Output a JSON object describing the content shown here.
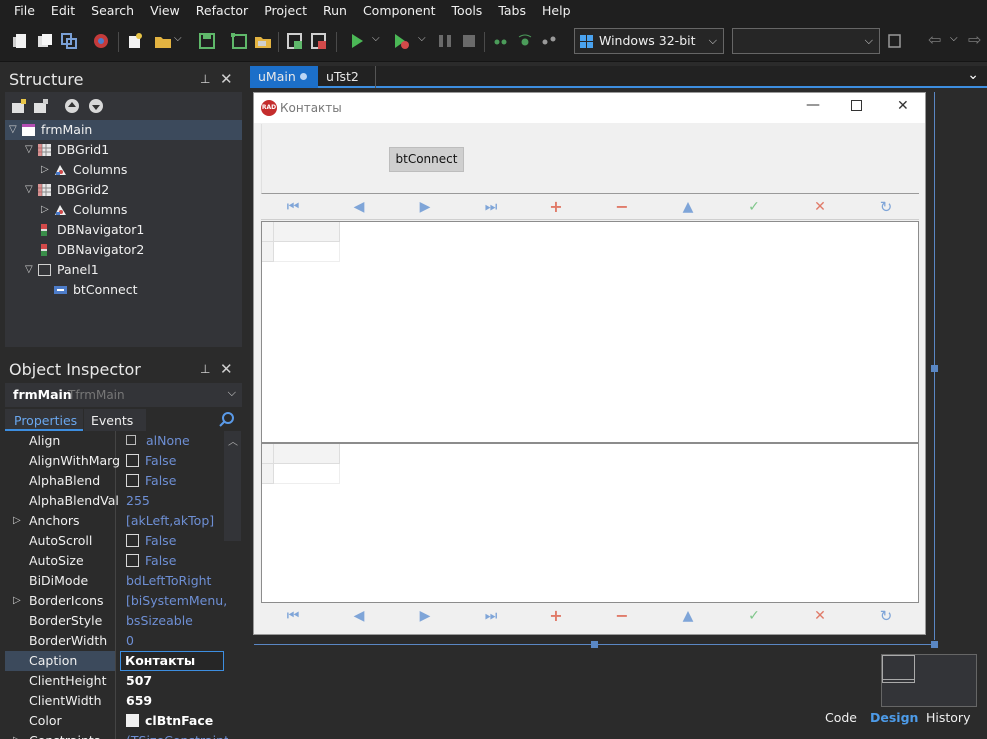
{
  "menu": [
    "File",
    "Edit",
    "Search",
    "View",
    "Refactor",
    "Project",
    "Run",
    "Component",
    "Tools",
    "Tabs",
    "Help"
  ],
  "toolbar": {
    "platform_value": "Windows 32-bit",
    "config_value": ""
  },
  "structure": {
    "title": "Structure",
    "tree": [
      {
        "label": "frmMain",
        "icon": "form-icon",
        "level": 0,
        "expanded": true,
        "selected": true
      },
      {
        "label": "DBGrid1",
        "icon": "grid-icon",
        "level": 1,
        "expanded": true
      },
      {
        "label": "Columns",
        "icon": "columns-icon",
        "level": 2,
        "expanded": false
      },
      {
        "label": "DBGrid2",
        "icon": "grid-icon",
        "level": 1,
        "expanded": true
      },
      {
        "label": "Columns",
        "icon": "columns-icon",
        "level": 2,
        "expanded": false
      },
      {
        "label": "DBNavigator1",
        "icon": "navigator-icon",
        "level": 1
      },
      {
        "label": "DBNavigator2",
        "icon": "navigator-icon",
        "level": 1
      },
      {
        "label": "Panel1",
        "icon": "panel-icon",
        "level": 1,
        "expanded": true
      },
      {
        "label": "btConnect",
        "icon": "button-icon",
        "level": 2
      }
    ]
  },
  "object_inspector": {
    "title": "Object Inspector",
    "object_name": "frmMain",
    "object_type": "TfrmMain",
    "tabs": [
      "Properties",
      "Events"
    ],
    "properties": [
      {
        "name": "Align",
        "value": "alNone",
        "kind": "enum"
      },
      {
        "name": "AlignWithMargins",
        "value": "False",
        "kind": "bool"
      },
      {
        "name": "AlphaBlend",
        "value": "False",
        "kind": "bool"
      },
      {
        "name": "AlphaBlendValue",
        "value": "255",
        "kind": "plain"
      },
      {
        "name": "Anchors",
        "value": "[akLeft,akTop]",
        "kind": "set"
      },
      {
        "name": "AutoScroll",
        "value": "False",
        "kind": "bool"
      },
      {
        "name": "AutoSize",
        "value": "False",
        "kind": "bool"
      },
      {
        "name": "BiDiMode",
        "value": "bdLeftToRight",
        "kind": "plain"
      },
      {
        "name": "BorderIcons",
        "value": "[biSystemMenu,biMinimize,biMaximize]",
        "kind": "set"
      },
      {
        "name": "BorderStyle",
        "value": "bsSizeable",
        "kind": "plain"
      },
      {
        "name": "BorderWidth",
        "value": "0",
        "kind": "plain"
      },
      {
        "name": "Caption",
        "value": "Контакты",
        "kind": "edit",
        "selected": true
      },
      {
        "name": "ClientHeight",
        "value": "507",
        "kind": "bold"
      },
      {
        "name": "ClientWidth",
        "value": "659",
        "kind": "bold"
      },
      {
        "name": "Color",
        "value": "clBtnFace",
        "kind": "color"
      },
      {
        "name": "Constraints",
        "value": "(TSizeConstraints)",
        "kind": "set"
      }
    ]
  },
  "editor": {
    "tabs": [
      "uMain",
      "uTst2"
    ],
    "active_tab": 0
  },
  "form": {
    "caption": "Контакты",
    "icon_text": "RAD",
    "connect_button": "btConnect"
  },
  "bottom_tabs": [
    "Code",
    "Design",
    "History"
  ],
  "colors": {
    "accent": "#3d8ee0",
    "nav_blue": "#7fa5d8",
    "nav_red": "#e07a68",
    "nav_green": "#7fc68a"
  }
}
